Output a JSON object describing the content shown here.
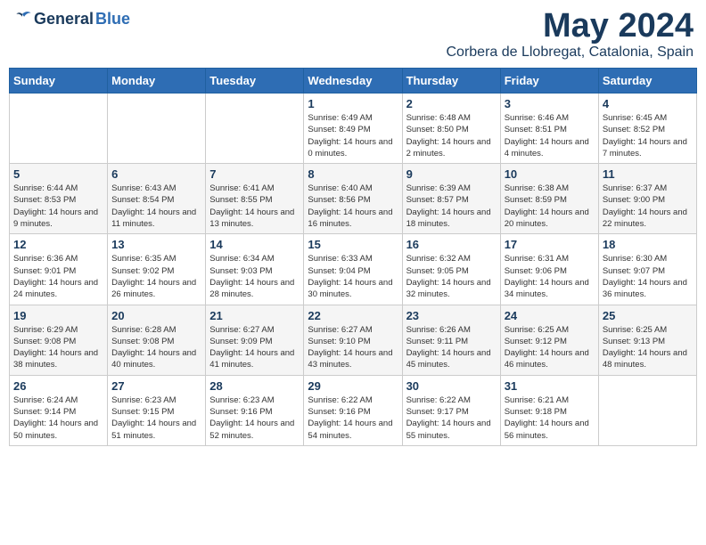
{
  "header": {
    "logo_general": "General",
    "logo_blue": "Blue",
    "month": "May 2024",
    "location": "Corbera de Llobregat, Catalonia, Spain"
  },
  "weekdays": [
    "Sunday",
    "Monday",
    "Tuesday",
    "Wednesday",
    "Thursday",
    "Friday",
    "Saturday"
  ],
  "weeks": [
    [
      {
        "day": "",
        "sunrise": "",
        "sunset": "",
        "daylight": ""
      },
      {
        "day": "",
        "sunrise": "",
        "sunset": "",
        "daylight": ""
      },
      {
        "day": "",
        "sunrise": "",
        "sunset": "",
        "daylight": ""
      },
      {
        "day": "1",
        "sunrise": "Sunrise: 6:49 AM",
        "sunset": "Sunset: 8:49 PM",
        "daylight": "Daylight: 14 hours and 0 minutes."
      },
      {
        "day": "2",
        "sunrise": "Sunrise: 6:48 AM",
        "sunset": "Sunset: 8:50 PM",
        "daylight": "Daylight: 14 hours and 2 minutes."
      },
      {
        "day": "3",
        "sunrise": "Sunrise: 6:46 AM",
        "sunset": "Sunset: 8:51 PM",
        "daylight": "Daylight: 14 hours and 4 minutes."
      },
      {
        "day": "4",
        "sunrise": "Sunrise: 6:45 AM",
        "sunset": "Sunset: 8:52 PM",
        "daylight": "Daylight: 14 hours and 7 minutes."
      }
    ],
    [
      {
        "day": "5",
        "sunrise": "Sunrise: 6:44 AM",
        "sunset": "Sunset: 8:53 PM",
        "daylight": "Daylight: 14 hours and 9 minutes."
      },
      {
        "day": "6",
        "sunrise": "Sunrise: 6:43 AM",
        "sunset": "Sunset: 8:54 PM",
        "daylight": "Daylight: 14 hours and 11 minutes."
      },
      {
        "day": "7",
        "sunrise": "Sunrise: 6:41 AM",
        "sunset": "Sunset: 8:55 PM",
        "daylight": "Daylight: 14 hours and 13 minutes."
      },
      {
        "day": "8",
        "sunrise": "Sunrise: 6:40 AM",
        "sunset": "Sunset: 8:56 PM",
        "daylight": "Daylight: 14 hours and 16 minutes."
      },
      {
        "day": "9",
        "sunrise": "Sunrise: 6:39 AM",
        "sunset": "Sunset: 8:57 PM",
        "daylight": "Daylight: 14 hours and 18 minutes."
      },
      {
        "day": "10",
        "sunrise": "Sunrise: 6:38 AM",
        "sunset": "Sunset: 8:59 PM",
        "daylight": "Daylight: 14 hours and 20 minutes."
      },
      {
        "day": "11",
        "sunrise": "Sunrise: 6:37 AM",
        "sunset": "Sunset: 9:00 PM",
        "daylight": "Daylight: 14 hours and 22 minutes."
      }
    ],
    [
      {
        "day": "12",
        "sunrise": "Sunrise: 6:36 AM",
        "sunset": "Sunset: 9:01 PM",
        "daylight": "Daylight: 14 hours and 24 minutes."
      },
      {
        "day": "13",
        "sunrise": "Sunrise: 6:35 AM",
        "sunset": "Sunset: 9:02 PM",
        "daylight": "Daylight: 14 hours and 26 minutes."
      },
      {
        "day": "14",
        "sunrise": "Sunrise: 6:34 AM",
        "sunset": "Sunset: 9:03 PM",
        "daylight": "Daylight: 14 hours and 28 minutes."
      },
      {
        "day": "15",
        "sunrise": "Sunrise: 6:33 AM",
        "sunset": "Sunset: 9:04 PM",
        "daylight": "Daylight: 14 hours and 30 minutes."
      },
      {
        "day": "16",
        "sunrise": "Sunrise: 6:32 AM",
        "sunset": "Sunset: 9:05 PM",
        "daylight": "Daylight: 14 hours and 32 minutes."
      },
      {
        "day": "17",
        "sunrise": "Sunrise: 6:31 AM",
        "sunset": "Sunset: 9:06 PM",
        "daylight": "Daylight: 14 hours and 34 minutes."
      },
      {
        "day": "18",
        "sunrise": "Sunrise: 6:30 AM",
        "sunset": "Sunset: 9:07 PM",
        "daylight": "Daylight: 14 hours and 36 minutes."
      }
    ],
    [
      {
        "day": "19",
        "sunrise": "Sunrise: 6:29 AM",
        "sunset": "Sunset: 9:08 PM",
        "daylight": "Daylight: 14 hours and 38 minutes."
      },
      {
        "day": "20",
        "sunrise": "Sunrise: 6:28 AM",
        "sunset": "Sunset: 9:08 PM",
        "daylight": "Daylight: 14 hours and 40 minutes."
      },
      {
        "day": "21",
        "sunrise": "Sunrise: 6:27 AM",
        "sunset": "Sunset: 9:09 PM",
        "daylight": "Daylight: 14 hours and 41 minutes."
      },
      {
        "day": "22",
        "sunrise": "Sunrise: 6:27 AM",
        "sunset": "Sunset: 9:10 PM",
        "daylight": "Daylight: 14 hours and 43 minutes."
      },
      {
        "day": "23",
        "sunrise": "Sunrise: 6:26 AM",
        "sunset": "Sunset: 9:11 PM",
        "daylight": "Daylight: 14 hours and 45 minutes."
      },
      {
        "day": "24",
        "sunrise": "Sunrise: 6:25 AM",
        "sunset": "Sunset: 9:12 PM",
        "daylight": "Daylight: 14 hours and 46 minutes."
      },
      {
        "day": "25",
        "sunrise": "Sunrise: 6:25 AM",
        "sunset": "Sunset: 9:13 PM",
        "daylight": "Daylight: 14 hours and 48 minutes."
      }
    ],
    [
      {
        "day": "26",
        "sunrise": "Sunrise: 6:24 AM",
        "sunset": "Sunset: 9:14 PM",
        "daylight": "Daylight: 14 hours and 50 minutes."
      },
      {
        "day": "27",
        "sunrise": "Sunrise: 6:23 AM",
        "sunset": "Sunset: 9:15 PM",
        "daylight": "Daylight: 14 hours and 51 minutes."
      },
      {
        "day": "28",
        "sunrise": "Sunrise: 6:23 AM",
        "sunset": "Sunset: 9:16 PM",
        "daylight": "Daylight: 14 hours and 52 minutes."
      },
      {
        "day": "29",
        "sunrise": "Sunrise: 6:22 AM",
        "sunset": "Sunset: 9:16 PM",
        "daylight": "Daylight: 14 hours and 54 minutes."
      },
      {
        "day": "30",
        "sunrise": "Sunrise: 6:22 AM",
        "sunset": "Sunset: 9:17 PM",
        "daylight": "Daylight: 14 hours and 55 minutes."
      },
      {
        "day": "31",
        "sunrise": "Sunrise: 6:21 AM",
        "sunset": "Sunset: 9:18 PM",
        "daylight": "Daylight: 14 hours and 56 minutes."
      },
      {
        "day": "",
        "sunrise": "",
        "sunset": "",
        "daylight": ""
      }
    ]
  ]
}
